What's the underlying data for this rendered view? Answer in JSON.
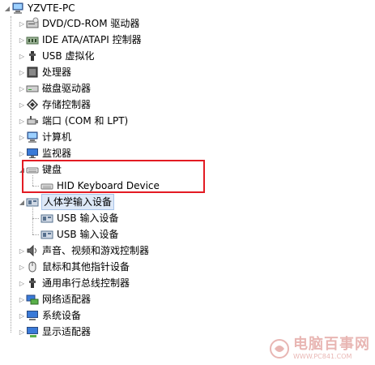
{
  "tree": {
    "root_label": "YZVTE-PC",
    "categories": [
      {
        "label": "DVD/CD-ROM 驱动器",
        "icon": "dvd-drive-icon"
      },
      {
        "label": "IDE ATA/ATAPI 控制器",
        "icon": "ide-controller-icon"
      },
      {
        "label": "USB 虚拟化",
        "icon": "usb-icon"
      },
      {
        "label": "处理器",
        "icon": "processor-icon"
      },
      {
        "label": "磁盘驱动器",
        "icon": "disk-drive-icon"
      },
      {
        "label": "存储控制器",
        "icon": "storage-controller-icon"
      },
      {
        "label": "端口 (COM 和 LPT)",
        "icon": "port-icon"
      },
      {
        "label": "计算机",
        "icon": "computer-icon"
      },
      {
        "label": "监视器",
        "icon": "monitor-icon"
      },
      {
        "label": "键盘",
        "icon": "keyboard-icon",
        "expanded": true
      },
      {
        "label": "HID Keyboard Device",
        "icon": "keyboard-icon",
        "child": true
      },
      {
        "label": "人体学输入设备",
        "icon": "hid-icon",
        "expanded": true,
        "selected": true
      },
      {
        "label": "USB 输入设备",
        "icon": "usb-input-device-icon",
        "child": true
      },
      {
        "label": "USB 输入设备",
        "icon": "usb-input-device-icon",
        "child": true
      },
      {
        "label": "声音、视频和游戏控制器",
        "icon": "sound-icon"
      },
      {
        "label": "鼠标和其他指针设备",
        "icon": "mouse-icon"
      },
      {
        "label": "通用串行总线控制器",
        "icon": "usb-controller-icon"
      },
      {
        "label": "网络适配器",
        "icon": "network-adapter-icon"
      },
      {
        "label": "系统设备",
        "icon": "system-device-icon"
      },
      {
        "label": "显示适配器",
        "icon": "display-adapter-icon"
      }
    ]
  },
  "colors": {
    "highlight_box": "#e31b23",
    "selection": "#dde8f7",
    "watermark": "#c03028"
  },
  "watermark": {
    "main": "电脑百事网",
    "sub": "WWW.PC841.COM"
  }
}
